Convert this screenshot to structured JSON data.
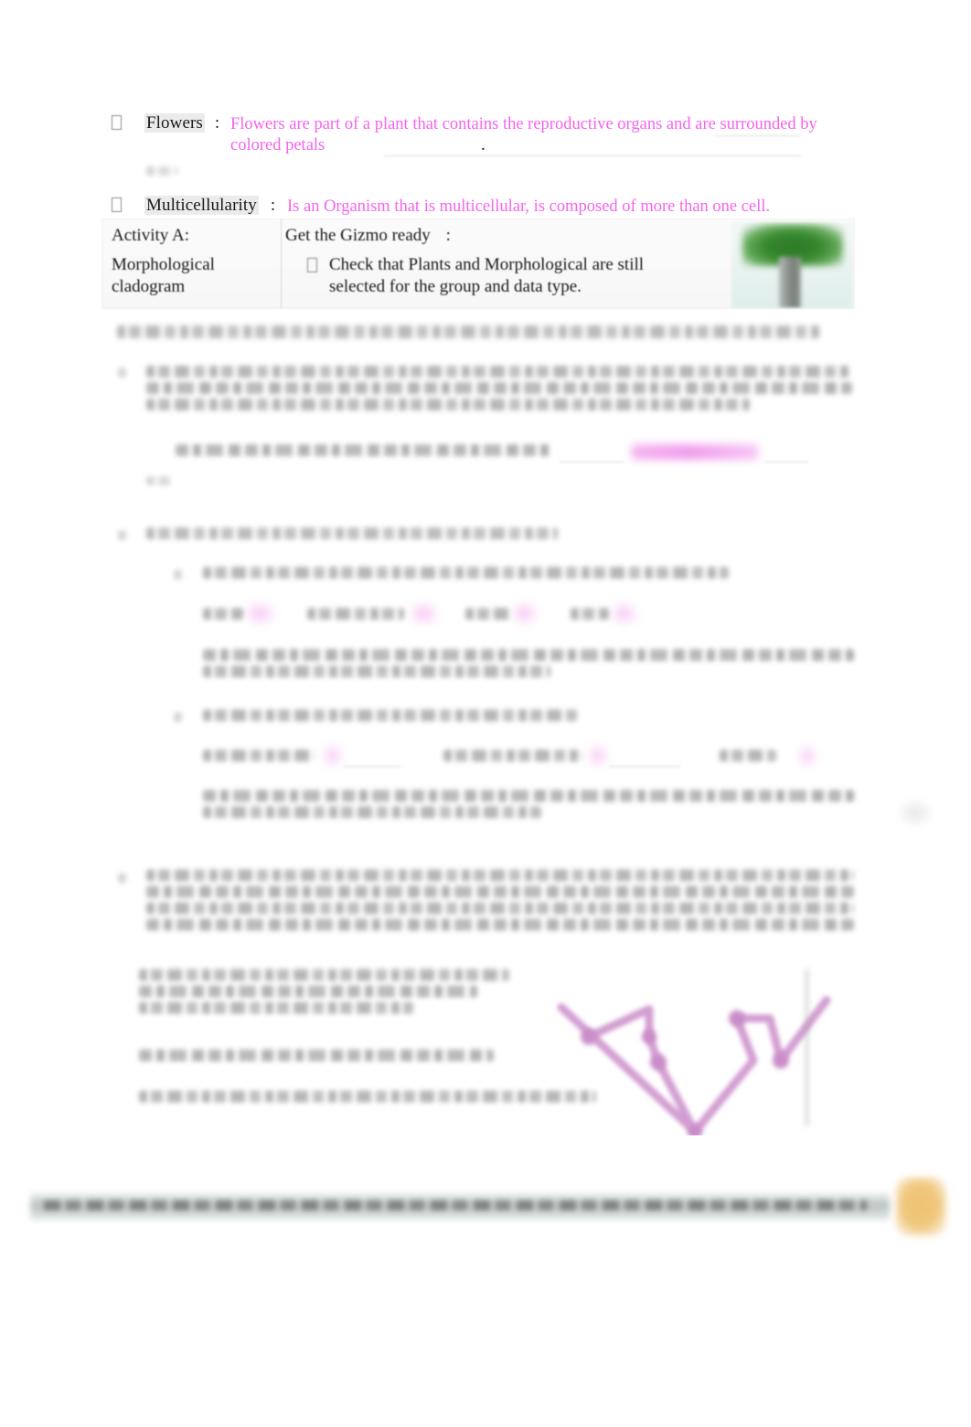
{
  "document": {
    "type": "student-worksheet",
    "legibility_note": "Most body text is blurred/illegible in the scan",
    "ink_colors": {
      "student_answer_pink": "#f563ef",
      "printed_black": "#1a1a1a",
      "cladogram_pink": "#cf96ce",
      "tree_green": "#2f7a28",
      "footer_bar": "#9baaa5",
      "footer_blob_orange": "#eec273"
    }
  },
  "vocab": [
    {
      "bullet": "missing-glyph-box",
      "term": "Flowers",
      "separator": ":",
      "answer": "Flowers are part of a plant that contains the reproductive organs and are surrounded by colored petals",
      "trailing_period": "."
    },
    {
      "bullet": "missing-glyph-box",
      "term": "Multicellularity",
      "separator": ":",
      "answer": "Is an Organism that is multicellular, is composed of more than one cell."
    }
  ],
  "activity_table": {
    "left_cell": {
      "heading": "Activity A:",
      "subtitle_line1": "Morphological",
      "subtitle_line2": "cladogram"
    },
    "right_cell": {
      "heading": "Get the Gizmo ready",
      "heading_colon": ":",
      "bullet": "missing-glyph-box",
      "instruction_line1": "Check that  Plants   and  Morphological    are still",
      "instruction_line2": "selected for the group and data type."
    },
    "image": {
      "name": "green-tree-illustration",
      "alt": "Stylized green tree with grey trunk"
    }
  },
  "blurred_sections": [
    {
      "id": "question-heading",
      "lines": 1,
      "style": "bold",
      "note": "Question: How do you build a simple cladogram based on physical characteristics?"
    },
    {
      "id": "item-1-body",
      "lines": 3
    },
    {
      "id": "item-1-prompt",
      "lines": 1,
      "has_pink_answer": true
    },
    {
      "id": "item-2-heading",
      "lines": 1
    },
    {
      "id": "item-2a-question",
      "lines": 1
    },
    {
      "id": "item-2a-labels",
      "count": 4,
      "has_pink_answer": true
    },
    {
      "id": "item-2a-note",
      "lines": 2
    },
    {
      "id": "item-2b-question",
      "lines": 1
    },
    {
      "id": "item-2b-labels",
      "count": 3,
      "has_pink_answer": true
    },
    {
      "id": "item-2b-note",
      "lines": 2
    },
    {
      "id": "item-3-body",
      "lines": 4
    },
    {
      "id": "item-3-sub-a",
      "lines": 3
    },
    {
      "id": "item-3-sub-b",
      "lines": 1
    },
    {
      "id": "item-3-sub-c",
      "lines": 1
    }
  ],
  "cladogram": {
    "name": "hand-drawn-morphological-cladogram",
    "color": "#cf96ce",
    "node_count": 5,
    "branch_count": 6,
    "has_right_vertical_axis": true
  },
  "footer": {
    "bar": "blurred-grey-green-footer-bar",
    "blob": "orange-page-corner-mark"
  }
}
